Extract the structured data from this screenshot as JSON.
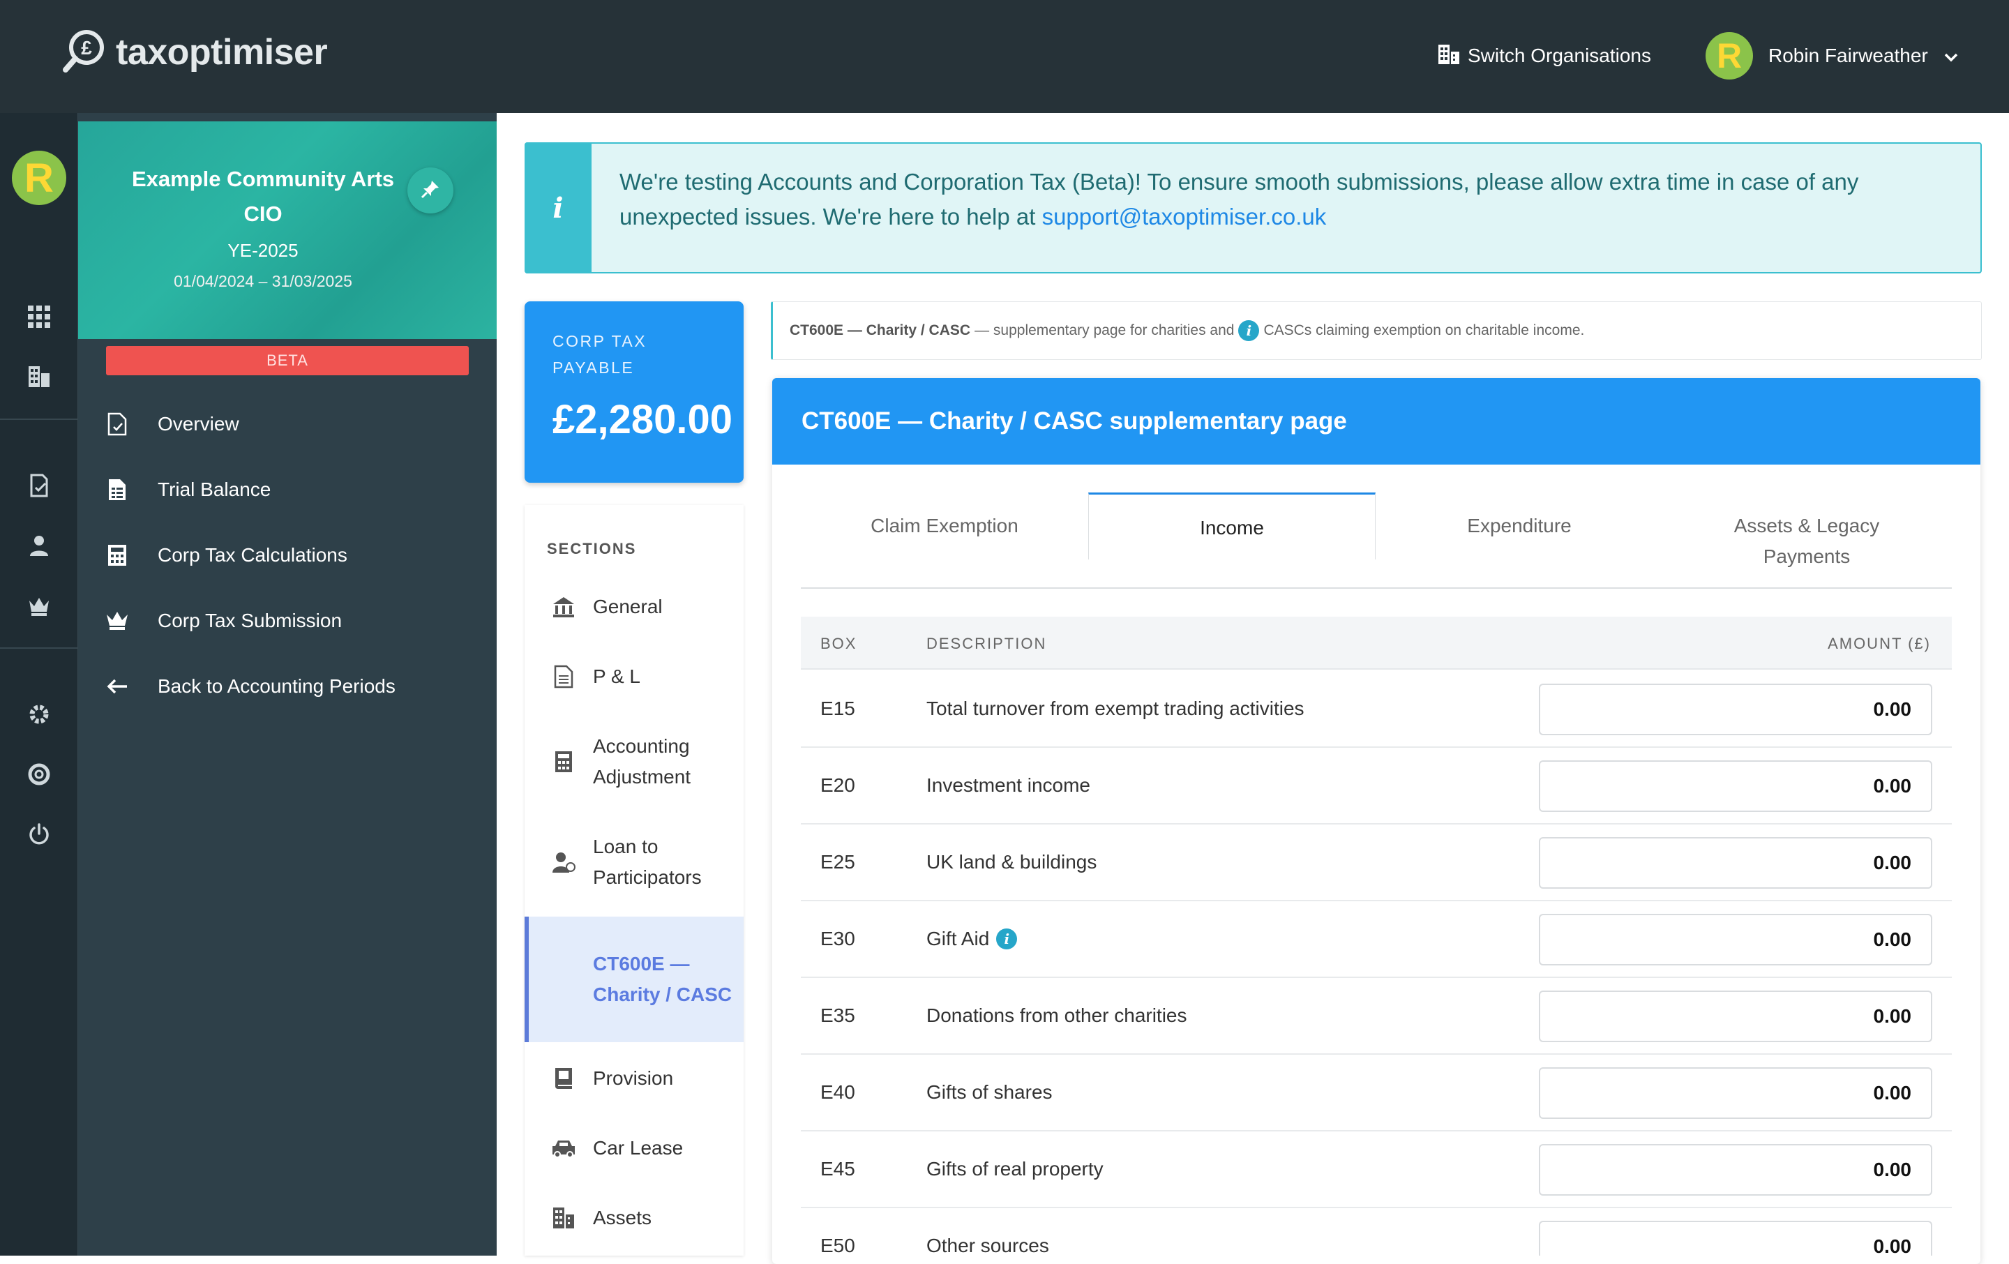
{
  "app": {
    "brand": "taxoptimiser"
  },
  "topbar": {
    "switch_org": "Switch Organisations",
    "user_initial": "R",
    "user_name": "Robin Fairweather"
  },
  "rail": {
    "avatar_initial": "R",
    "icons": [
      "apps-grid-icon",
      "organisation-icon",
      "document-check-icon",
      "user-icon",
      "crown-icon",
      "settings-icon",
      "help-lifebuoy-icon",
      "power-icon"
    ]
  },
  "org": {
    "name": "Example Community Arts CIO",
    "period": "YE-2025",
    "dates": "01/04/2024 – 31/03/2025",
    "badge": "BETA"
  },
  "nav": [
    {
      "label": "Overview"
    },
    {
      "label": "Trial Balance"
    },
    {
      "label": "Corp Tax Calculations"
    },
    {
      "label": "Corp Tax Submission"
    },
    {
      "label": "Back to Accounting Periods"
    }
  ],
  "banner": {
    "text": "We're testing Accounts and Corporation Tax (Beta)! To ensure smooth submissions, please allow extra time in case of any unexpected issues. We're here to help at ",
    "link": "support@taxoptimiser.co.uk"
  },
  "tax_card": {
    "label": "CORP TAX PAYABLE",
    "value": "£2,280.00"
  },
  "sections": {
    "title": "SECTIONS",
    "items": [
      {
        "label": "General"
      },
      {
        "label": "P & L"
      },
      {
        "label": "Accounting Adjustment"
      },
      {
        "label": "Loan to Participators"
      },
      {
        "label": "CT600E — Charity / CASC"
      },
      {
        "label": "Provision"
      },
      {
        "label": "Car Lease"
      },
      {
        "label": "Assets"
      }
    ],
    "active_index": 4
  },
  "info_strip": {
    "bold": "CT600E — Charity / CASC",
    "text_before": " — supplementary page for charities and",
    "text_after": "CASCs claiming exemption on charitable income."
  },
  "card": {
    "title": "CT600E — Charity / CASC supplementary page",
    "tabs": [
      {
        "label": "Claim Exemption"
      },
      {
        "label": "Income"
      },
      {
        "label": "Expenditure"
      },
      {
        "label": "Assets & Legacy Payments"
      }
    ],
    "active_tab": 1,
    "table": {
      "headers": {
        "box": "BOX",
        "description": "DESCRIPTION",
        "amount": "AMOUNT (£)"
      },
      "rows": [
        {
          "box": "E15",
          "description": "Total turnover from exempt trading activities",
          "amount": "0.00"
        },
        {
          "box": "E20",
          "description": "Investment income",
          "amount": "0.00"
        },
        {
          "box": "E25",
          "description": "UK land & buildings",
          "amount": "0.00"
        },
        {
          "box": "E30",
          "description": "Gift Aid",
          "amount": "0.00",
          "info": true
        },
        {
          "box": "E35",
          "description": "Donations from other charities",
          "amount": "0.00"
        },
        {
          "box": "E40",
          "description": "Gifts of shares",
          "amount": "0.00"
        },
        {
          "box": "E45",
          "description": "Gifts of real property",
          "amount": "0.00"
        },
        {
          "box": "E50",
          "description": "Other sources",
          "amount": "0.00"
        }
      ]
    }
  },
  "colors": {
    "topbar": "#263238",
    "accent_blue": "#2196f3",
    "teal": "#26a69a",
    "beta_red": "#ef5350",
    "info_cyan": "#3bbfcf"
  }
}
